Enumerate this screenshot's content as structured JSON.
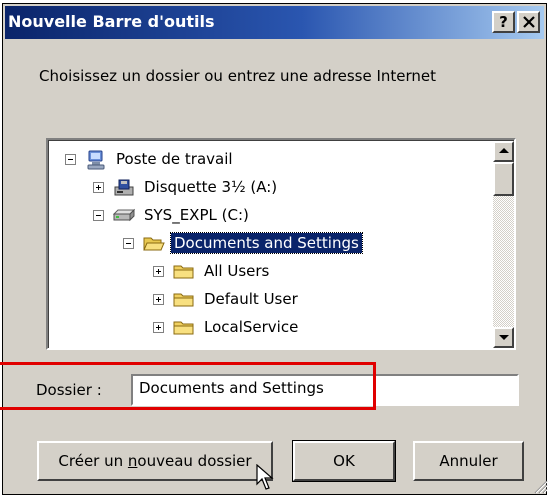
{
  "dialog": {
    "title": "Nouvelle Barre d'outils",
    "help_glyph": "?",
    "close_glyph": "✕",
    "prompt": "Choisissez un dossier ou entrez une adresse Internet"
  },
  "tree": {
    "items": [
      {
        "label": "Poste de travail",
        "icon": "computer-icon",
        "expander": "minus",
        "selected": false
      },
      {
        "label": "Disquette 3½ (A:)",
        "icon": "floppy-drive-icon",
        "expander": "plus",
        "selected": false
      },
      {
        "label": "SYS_EXPL (C:)",
        "icon": "hard-drive-icon",
        "expander": "minus",
        "selected": false
      },
      {
        "label": "Documents and Settings",
        "icon": "open-folder-icon",
        "expander": "minus",
        "selected": true
      },
      {
        "label": "All Users",
        "icon": "folder-icon",
        "expander": "plus",
        "selected": false
      },
      {
        "label": "Default User",
        "icon": "folder-icon",
        "expander": "plus",
        "selected": false
      },
      {
        "label": "LocalService",
        "icon": "folder-icon",
        "expander": "plus",
        "selected": false
      }
    ]
  },
  "folder": {
    "label": "Dossier :",
    "value": "Documents and Settings"
  },
  "buttons": {
    "new_folder_prefix": "Créer un ",
    "new_folder_accel": "n",
    "new_folder_suffix": "ouveau dossier",
    "ok": "OK",
    "cancel": "Annuler"
  },
  "colors": {
    "titlebar_start": "#0a246a",
    "titlebar_end": "#a6caf0",
    "selection": "#0a246a",
    "highlight_box": "#e00000",
    "dialog_face": "#d4d0c8"
  }
}
